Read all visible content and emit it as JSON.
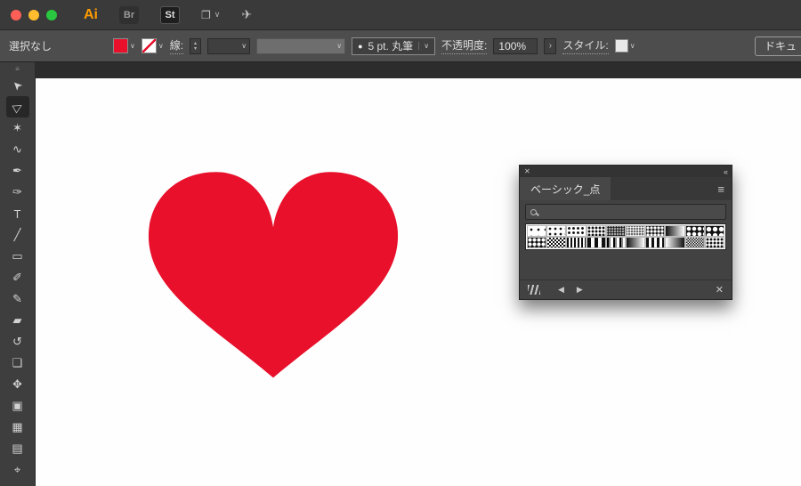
{
  "icons": {
    "chevron_down": "∨",
    "stepper_up": "▴",
    "stepper_down": "▾",
    "submenu": "›",
    "workspace": "❐",
    "share": "✈",
    "grip": "≡",
    "close": "✕",
    "collapse": "«",
    "menu": "≡",
    "prev": "◀",
    "next": "▶",
    "remove": "✕",
    "brush_dot": "●"
  },
  "titlebar": {
    "app_label": "Ai",
    "bridge_label": "Br",
    "stock_label": "St",
    "accent_color": "#ff9c00",
    "traffic_colors": [
      "#ff5f57",
      "#febc2e",
      "#2ac840"
    ]
  },
  "controlbar": {
    "selection_status": "選択なし",
    "stroke_label": "線:",
    "brush_preview": "5 pt. 丸筆",
    "opacity_label": "不透明度:",
    "opacity_value": "100%",
    "style_label": "スタイル:",
    "document_button": "ドキュ",
    "fill_color": "#e8102b"
  },
  "toolbar": {
    "tools": [
      {
        "name": "selection",
        "glyph": "➤",
        "rot": -135,
        "active": false
      },
      {
        "name": "direct-selection",
        "glyph": "▷",
        "rot": -30,
        "active": true
      },
      {
        "name": "magic-wand",
        "glyph": "✶",
        "active": false
      },
      {
        "name": "lasso",
        "glyph": "∿",
        "active": false
      },
      {
        "name": "pen",
        "glyph": "✒",
        "active": false
      },
      {
        "name": "curvature",
        "glyph": "✑",
        "active": false
      },
      {
        "name": "type",
        "glyph": "T",
        "active": false
      },
      {
        "name": "line-segment",
        "glyph": "╱",
        "active": false
      },
      {
        "name": "rectangle",
        "glyph": "▭",
        "active": false
      },
      {
        "name": "paintbrush",
        "glyph": "✐",
        "active": false
      },
      {
        "name": "pencil",
        "glyph": "✎",
        "active": false
      },
      {
        "name": "eraser",
        "glyph": "▰",
        "active": false
      },
      {
        "name": "rotate",
        "glyph": "↺",
        "active": false
      },
      {
        "name": "scale",
        "glyph": "❏",
        "active": false
      },
      {
        "name": "free-transform",
        "glyph": "✥",
        "active": false
      },
      {
        "name": "shape-builder",
        "glyph": "▣",
        "active": false
      },
      {
        "name": "mesh",
        "glyph": "▦",
        "active": false
      },
      {
        "name": "gradient",
        "glyph": "▤",
        "active": false
      },
      {
        "name": "eyedropper",
        "glyph": "⌖",
        "active": false
      }
    ]
  },
  "canvas": {
    "heart_color": "#e8102b"
  },
  "panel": {
    "tab_label": "ベーシック_点",
    "swatch_rows": [
      [
        {
          "name": "dots-8",
          "type": "dots",
          "fg": "#111",
          "bg": "#fff",
          "s": 8,
          "r": 1.1
        },
        {
          "name": "dots-6",
          "type": "dots",
          "fg": "#111",
          "bg": "#fff",
          "s": 6,
          "r": 1.1
        },
        {
          "name": "dots-5",
          "type": "dots",
          "fg": "#111",
          "bg": "#fff",
          "s": 5,
          "r": 1.2
        },
        {
          "name": "dots-4",
          "type": "dots",
          "fg": "#111",
          "bg": "#fff",
          "s": 4,
          "r": 1.2
        },
        {
          "name": "dots-3",
          "type": "dots",
          "fg": "#111",
          "bg": "#fff",
          "s": 3,
          "r": 1.1
        },
        {
          "name": "dots-inv-3",
          "type": "dots",
          "fg": "#fff",
          "bg": "#111",
          "s": 3,
          "r": 1.1
        },
        {
          "name": "dots-inv-4",
          "type": "dots",
          "fg": "#fff",
          "bg": "#111",
          "s": 4,
          "r": 1.4
        },
        {
          "name": "halftone-gradient",
          "type": "grad",
          "fg": "#111",
          "bg": "#fff"
        },
        {
          "name": "dots-inv-6",
          "type": "dots",
          "fg": "#fff",
          "bg": "#111",
          "s": 6,
          "r": 2
        },
        {
          "name": "dots-inv-7",
          "type": "dots",
          "fg": "#fff",
          "bg": "#111",
          "s": 7,
          "r": 2.4
        }
      ],
      [
        {
          "name": "dots-inv-5",
          "type": "dots",
          "fg": "#fff",
          "bg": "#111",
          "s": 5,
          "r": 1.8
        },
        {
          "name": "checker-4",
          "type": "checker",
          "fg": "#111",
          "bg": "#fff",
          "s": 4
        },
        {
          "name": "stripes-2",
          "type": "stripes",
          "fg": "#111",
          "bg": "#fff",
          "w": 2
        },
        {
          "name": "stripes-4",
          "type": "stripes",
          "fg": "#111",
          "bg": "#fff",
          "w": 4
        },
        {
          "name": "gradient-bars",
          "type": "vbars",
          "fg": "#111",
          "bg": "#fff"
        },
        {
          "name": "gradient-h",
          "type": "grad",
          "fg": "#111",
          "bg": "#fff"
        },
        {
          "name": "stripes-3",
          "type": "stripes",
          "fg": "#111",
          "bg": "#fff",
          "w": 3
        },
        {
          "name": "gradient-h-rev",
          "type": "grad",
          "fg": "#fff",
          "bg": "#111"
        },
        {
          "name": "checker-3",
          "type": "checker",
          "fg": "#111",
          "bg": "#fff",
          "s": 3
        },
        {
          "name": "dots-4b",
          "type": "dots",
          "fg": "#111",
          "bg": "#fff",
          "s": 4,
          "r": 1.2
        }
      ]
    ]
  }
}
